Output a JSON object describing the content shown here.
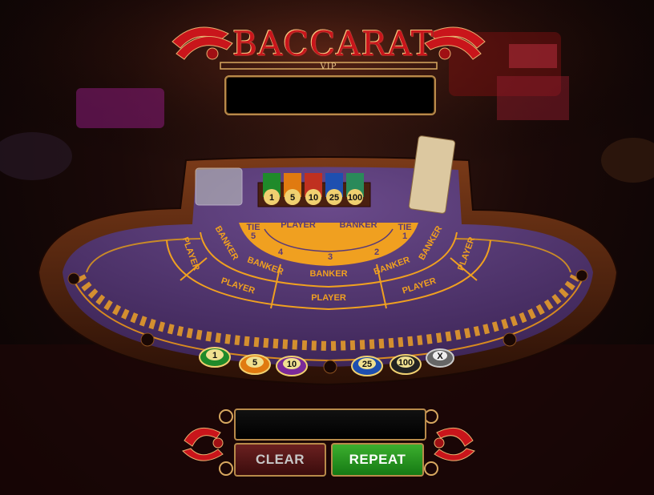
{
  "logo": {
    "title": "BACCARAT",
    "subtitle": "VIP"
  },
  "table": {
    "center_row": {
      "tie_left": "TIE",
      "player": "PLAYER",
      "banker": "BANKER",
      "tie_right": "TIE",
      "tie_left_seat": "5",
      "tie_right_seat": "1"
    },
    "seat_numbers": [
      "4",
      "3",
      "2"
    ],
    "seats": {
      "seat5_banker": "BANKER",
      "seat5_player": "PLAYER",
      "seat4_banker": "BANKER",
      "seat4_player": "PLAYER",
      "seat3_banker": "BANKER",
      "seat3_player": "PLAYER",
      "seat2_banker": "BANKER",
      "seat2_player": "PLAYER",
      "seat1_banker": "BANKER",
      "seat1_player": "PLAYER"
    },
    "tray_chips": [
      "1",
      "5",
      "10",
      "25",
      "100"
    ]
  },
  "chips": [
    {
      "label": "1",
      "color": "#1f8a2a"
    },
    {
      "label": "5",
      "color": "#e07a10"
    },
    {
      "label": "10",
      "color": "#7a2a9a"
    },
    {
      "label": "25",
      "color": "#1e4fb0"
    },
    {
      "label": "100",
      "color": "#222222"
    },
    {
      "label": "X",
      "color": "#888888"
    }
  ],
  "buttons": {
    "clear": "CLEAR",
    "repeat": "REPEAT"
  },
  "colors": {
    "felt": "#5a3a78",
    "gold": "#f0a020",
    "wood": "#5a2a10"
  }
}
